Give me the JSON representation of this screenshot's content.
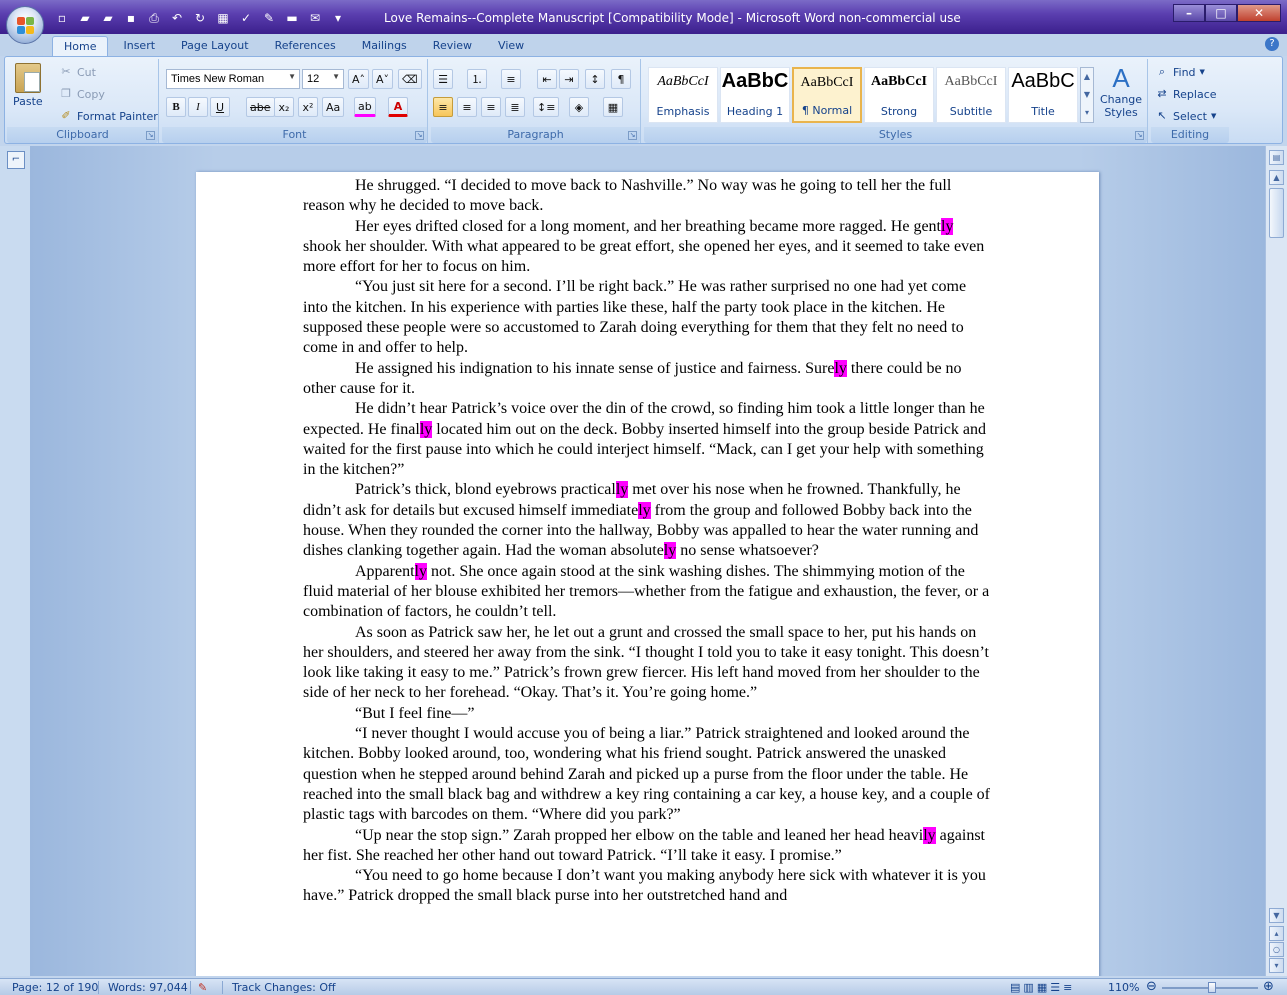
{
  "window": {
    "title": "Love Remains--Complete Manuscript [Compatibility Mode] - Microsoft Word non-commercial use",
    "controls": {
      "minimize": "–",
      "maximize": "□",
      "close": "✕"
    }
  },
  "ribbon_tabs": [
    "Home",
    "Insert",
    "Page Layout",
    "References",
    "Mailings",
    "Review",
    "View"
  ],
  "clipboard": {
    "paste": "Paste",
    "cut": "Cut",
    "copy": "Copy",
    "format_painter": "Format Painter",
    "label": "Clipboard"
  },
  "font": {
    "name": "Times New Roman",
    "size": "12",
    "label": "Font"
  },
  "paragraph": {
    "label": "Paragraph"
  },
  "styles": {
    "label": "Styles",
    "items": [
      {
        "sample": "AaBbCcI",
        "name": "Emphasis"
      },
      {
        "sample": "AaBbC",
        "name": "Heading 1"
      },
      {
        "sample": "AaBbCcI",
        "name": "¶ Normal"
      },
      {
        "sample": "AaBbCcI",
        "name": "Strong"
      },
      {
        "sample": "AaBbCcI",
        "name": "Subtitle"
      },
      {
        "sample": "AaBbC",
        "name": "Title"
      }
    ],
    "change_styles": "Change Styles"
  },
  "editing": {
    "find": "Find",
    "replace": "Replace",
    "select": "Select",
    "label": "Editing"
  },
  "document": {
    "paragraphs": [
      [
        "He shrugged. “I decided to move back to Nashville.” No way was he going to tell her the full reason why he decided to move back."
      ],
      [
        "Her eyes drifted closed for a long moment, and her breathing became more ragged. He gent",
        "ly",
        " shook her shoulder. With what appeared to be great effort, she opened her eyes, and it seemed to take even more effort for her to focus on him."
      ],
      [
        "“You just sit here for a second. I’ll be right back.” He was rather surprised no one had yet come into the kitchen. In his experience with parties like these, half the party took place in the kitchen. He supposed these people were so accustomed to Zarah doing everything for them that they felt no need to come in and offer to help."
      ],
      [
        "He assigned his indignation to his innate sense of justice and fairness. Sure",
        "ly",
        " there could be no other cause for it."
      ],
      [
        "He didn’t hear Patrick’s voice over the din of the crowd, so finding him took a little longer than he expected. He final",
        "ly",
        " located him out on the deck. Bobby inserted himself into the group beside Patrick and waited for the first pause into which he could interject himself. “Mack, can I get your help with something in the kitchen?”"
      ],
      [
        "Patrick’s thick, blond eyebrows practical",
        "ly",
        " met over his nose when he frowned. Thankfully, he didn’t ask for details but excused himself immediate",
        "ly",
        " from the group and followed Bobby back into the house. When they rounded the corner into the hallway, Bobby was appalled to hear the water running and dishes clanking together again. Had the woman absolute",
        "ly",
        " no sense whatsoever?"
      ],
      [
        "Apparent",
        "ly",
        " not. She once again stood at the sink washing dishes. The shimmying motion of the fluid material of her blouse exhibited her tremors—whether from the fatigue and exhaustion, the fever, or a combination of factors, he couldn’t tell."
      ],
      [
        "As soon as Patrick saw her, he let out a grunt and crossed the small space to her, put his hands on her shoulders, and steered her away from the sink. “I thought I told you to take it easy tonight. This doesn’t look like taking it easy to me.” Patrick’s frown grew fiercer. His left hand moved from her shoulder to the side of her neck to her forehead. “Okay. That’s it. You’re going home.”"
      ],
      [
        "“But I feel fine—”"
      ],
      [
        "“I never thought I would accuse you of being a liar.” Patrick straightened and looked around the kitchen. Bobby looked around, too, wondering what his friend sought. Patrick answered the unasked question when he stepped around behind Zarah and picked up a purse from the floor under the table. He reached into the small black bag and withdrew a key ring containing a car key, a house key, and a couple of plastic tags with barcodes on them. “Where did you park?”"
      ],
      [
        "“Up near the stop sign.” Zarah propped her elbow on the table and leaned her head heavi",
        "ly",
        " against her fist. She reached her other hand out toward Patrick. “I’ll take it easy. I promise.”"
      ],
      [
        "“You need to go home because I don’t want you making anybody here sick with whatever it is you have.” Patrick dropped the small black purse into her outstretched hand and"
      ]
    ],
    "highlight_color": "#ff00ff"
  },
  "status": {
    "page": "Page: 12 of 190",
    "words": "Words: 97,044",
    "track_changes": "Track Changes: Off",
    "zoom": "110%"
  }
}
